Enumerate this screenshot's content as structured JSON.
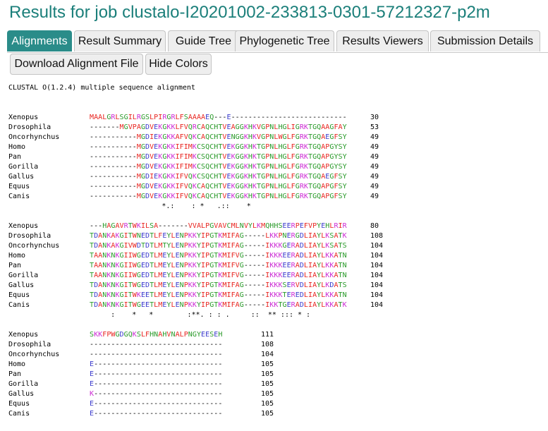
{
  "page_title": "Results for job clustalo-I20201002-233813-0301-57212327-p2m",
  "tabs": [
    {
      "label": "Alignments",
      "active": true
    },
    {
      "label": "Result Summary",
      "active": false
    },
    {
      "label": "Guide Tree",
      "active": false
    },
    {
      "label": "Phylogenetic Tree",
      "active": false
    },
    {
      "label": "Results Viewers",
      "active": false
    },
    {
      "label": "Submission Details",
      "active": false
    }
  ],
  "buttons": {
    "download": "Download Alignment File",
    "hide_colors": "Hide Colors"
  },
  "alignment": {
    "header": "CLUSTAL O(1.2.4) multiple sequence alignment",
    "species": [
      "Xenopus",
      "Drosophila",
      "Oncorhynchus",
      "Homo",
      "Pan",
      "Gorilla",
      "Gallus",
      "Equus",
      "Canis"
    ],
    "blocks": [
      {
        "sequences": [
          "MAALGRLSGILRGSLPIRGRLFSAAAAEQ---E---------------------------",
          "-------MGVPAGDVEKGKKLFVQRCAQCHTVEAGGKHKVGPNLHGLIGRKTGQAAGFAY",
          "-----------MGDIEKGKKAFVQKCAQCHTVENGGKHKVGPNLWGLFGRKTGQAEGFSY",
          "-----------MGDVEKGKKIFIMKCSQCHTVEKGGKHKTGPNLHGLFGRKTGQAPGYSY",
          "-----------MGDVEKGKKIFIMKCSQCHTVEKGGKHKTGPNLHGLFGRKTGQAPGYSY",
          "-----------MGDVEKGKKIFIMKCSQCHTVEKGGKHKTGPNLHGLFGRKTGQAPGYSY",
          "-----------MGDIEKGKKIFVQKCSQCHTVEKGGKHKTGPNLHGLFGRKTGQAEGFSY",
          "-----------MGDVEKGKKIFVQKCAQCHTVEKGGKHKTGPNLHGLFGRKTGQAPGFSY",
          "-----------MGDVEKGKKIFVQKCAQCHTVEKGGKHKTGPNLHGLFGRKTGQAPGFSY"
        ],
        "numbers": [
          "30",
          "53",
          "49",
          "49",
          "49",
          "49",
          "49",
          "49",
          "49"
        ],
        "consensus": "                 *.:    : *   .::    *"
      },
      {
        "sequences": [
          "---HAGAVRTWKILSA-------VVALPGVAVCMLNVYLKMQHHSEERPEFVPYEHLRIR",
          "TDANKAKGITWNEDTLFEYLENPKKYIPGTKMIFAG-----LKKPNERGDLIAYLKSATK",
          "TDANKAKGIVWDTDTLMTYLENPKKYIPGTKMIFAG-----IKKKGERADLIAYLKSATS",
          "TAANKNKGIIWGEDTLMEYLENPKKYIPGTKMIFVG-----IKKKEERADLIAYLKKATN",
          "TAANKNKGIIWGEDTLMEYLENPKKYIPGTKMIFVG-----IKKKEERADLIAYLKKATN",
          "TAANKNKGIIWGEDTLMEYLENPKKYIPGTKMIFVG-----IKKKEERADLIAYLKKATN",
          "TDANKNKGITWGEDTLMEYLENPKKYIPGTKMIFAG-----IKKKSERVDLIAYLKDATS",
          "TDANKNKGITWKEETLMEYLENPKKYIPGTKMIFAG-----IKKKTEREDLIAYLKKATN",
          "TDANKNKGITWGEETLMEYLENPKKYIPGTKMIFAG-----IKKTGERADLIAYLKKATK"
        ],
        "numbers": [
          "80",
          "108",
          "104",
          "104",
          "104",
          "104",
          "104",
          "104",
          "104"
        ],
        "consensus": "     :    *   *        :**. : : .     ::  ** ::: * :"
      },
      {
        "sequences": [
          "SKKFPWGDGQKSLFHNAHVNALPNGYEESEH",
          "-------------------------------",
          "-------------------------------",
          "E------------------------------",
          "E------------------------------",
          "E------------------------------",
          "K------------------------------",
          "E------------------------------",
          "E------------------------------"
        ],
        "numbers": [
          "111",
          "108",
          "104",
          "105",
          "105",
          "105",
          "105",
          "105",
          "105"
        ],
        "consensus": ""
      }
    ]
  },
  "colors": {
    "title": "#1b7f7a",
    "tab_active_bg": "#2a8c89",
    "residue_red_AVFPMILW": "#e8241f",
    "residue_blue_DE": "#3a3acc",
    "residue_magenta_RK": "#cc2ad4",
    "residue_green_STYHCNGQ": "#2a9a2a",
    "gap": "#000000"
  }
}
